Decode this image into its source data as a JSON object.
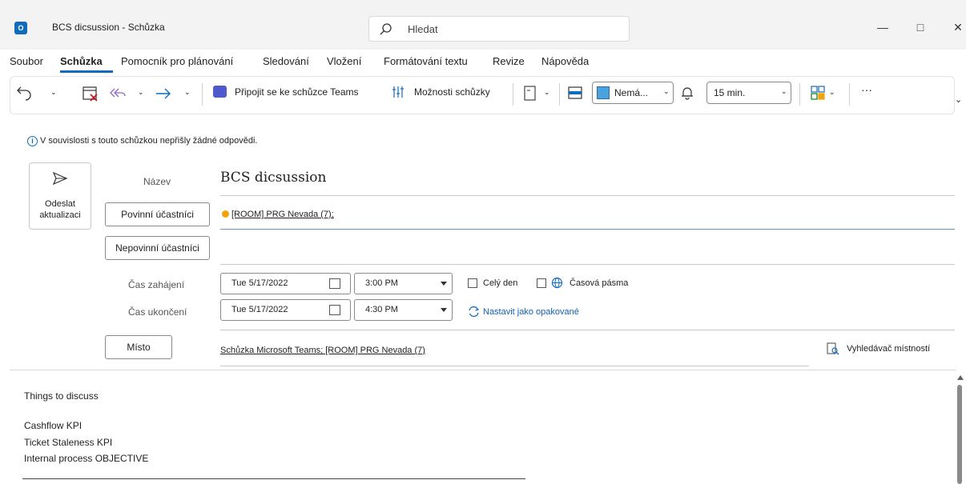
{
  "window": {
    "title": "BCS dicsussion  -  Schůzka",
    "app_icon": "O",
    "search_placeholder": "Hledat"
  },
  "menu": [
    "Soubor",
    "Schůzka",
    "Pomocník pro plánování",
    "Sledování",
    "Vložení",
    "Formátování textu",
    "Revize",
    "Nápověda"
  ],
  "toolbar": {
    "join_teams": "Připojit se ke schůzce Teams",
    "meeting_options": "Možnosti schůzky",
    "category": "Nemá...",
    "reminder": "15 min.",
    "more": "···"
  },
  "info_text": "V souvislosti s touto schůzkou nepřišly žádné odpovědi.",
  "send_button": {
    "line1": "Odeslat",
    "line2": "aktualizaci"
  },
  "form": {
    "title_label": "Název",
    "subject": "BCS dicsussion",
    "required_btn": "Povinní účastníci",
    "required_value": "[ROOM] PRG Nevada (7);",
    "optional_btn": "Nepovinní účastníci",
    "start_label": "Čas zahájení",
    "end_label": "Čas ukončení",
    "start_date": "Tue 5/17/2022",
    "start_time": "3:00 PM",
    "end_date": "Tue 5/17/2022",
    "end_time": "4:30 PM",
    "all_day": "Celý den",
    "time_zones": "Časová pásma",
    "recurring": "Nastavit jako opakované",
    "location_btn": "Místo",
    "location_value": "Schůzka Microsoft Teams; [ROOM] PRG Nevada (7)",
    "room_finder": "Vyhledávač místností"
  },
  "body": {
    "lines": [
      "Things to discuss",
      "",
      "Cashflow KPI",
      "Ticket Staleness KPI",
      "Internal process OBJECTIVE"
    ]
  }
}
